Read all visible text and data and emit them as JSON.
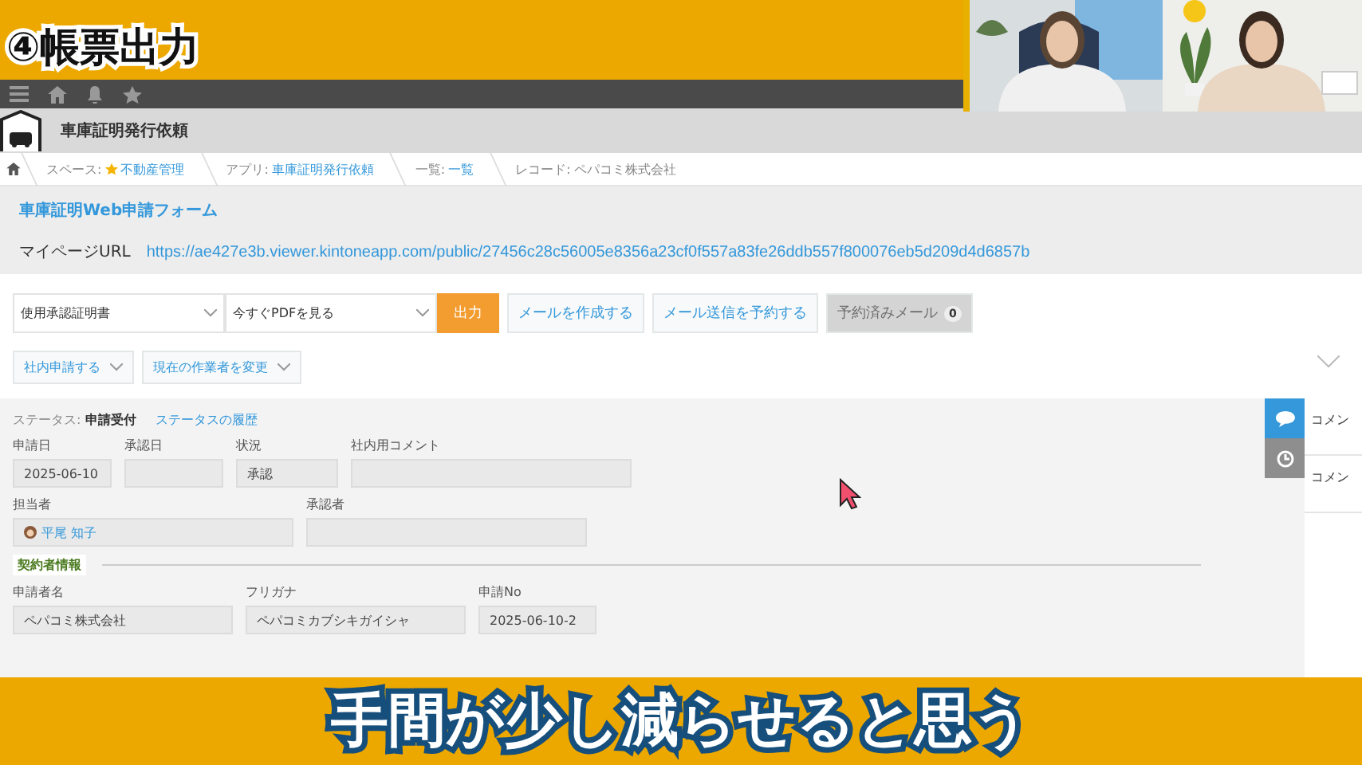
{
  "overlay_title": "④帳票出力",
  "subtitle": "手間が少し減らせると思う",
  "video_tiles": [
    {
      "kind": "picture"
    },
    {
      "kind": "picture"
    }
  ],
  "app": {
    "title": "車庫証明発行依頼"
  },
  "breadcrumb": [
    {
      "prefix": "スペース:",
      "label": "不動産管理",
      "starred": true,
      "link": true
    },
    {
      "prefix": "アプリ:",
      "label": "車庫証明発行依頼",
      "starred": false,
      "link": true
    },
    {
      "prefix": "一覧:",
      "label": "一覧",
      "starred": false,
      "link": true
    },
    {
      "prefix": "レコード:",
      "label": "ペパコミ株式会社",
      "starred": false,
      "link": false
    }
  ],
  "form_header": {
    "title": "車庫証明Web申請フォーム",
    "url_label": "マイページURL",
    "url": "https://ae427e3b.viewer.kintoneapp.com/public/27456c28c56005e8356a23cf0f557a83fe26ddb557f800076eb5d209d4d6857b"
  },
  "toolbar": [
    {
      "kind": "select",
      "value": "使用承認証明書"
    },
    {
      "kind": "select",
      "value": "今すぐPDFを見る"
    },
    {
      "kind": "primary",
      "label": "出力"
    },
    {
      "kind": "button",
      "label": "メールを作成する"
    },
    {
      "kind": "button",
      "label": "メール送信を予約する"
    },
    {
      "kind": "disabled",
      "label": "予約済みメール",
      "badge": "0"
    }
  ],
  "actions": [
    {
      "label": "社内申請する"
    },
    {
      "label": "現在の作業者を変更"
    }
  ],
  "status": {
    "label": "ステータス:",
    "value": "申請受付",
    "history_link": "ステータスの履歴"
  },
  "field_rows": [
    [
      {
        "label": "申請日",
        "value": "2025-06-10",
        "kind": "date"
      },
      {
        "label": "承認日",
        "kind": "date"
      },
      {
        "label": "状況",
        "value": "承認",
        "kind": "short"
      },
      {
        "label": "社内用コメント",
        "kind": "long"
      }
    ],
    [
      {
        "label": "担当者",
        "value": "平尾 知子",
        "kind": "user"
      },
      {
        "label": "承認者",
        "kind": "user"
      }
    ]
  ],
  "group": {
    "label": "契約者情報"
  },
  "group_rows": [
    [
      {
        "label": "申請者名",
        "value": "ペパコミ株式会社",
        "kind": "medium"
      },
      {
        "label": "フリガナ",
        "value": "ペパコミカブシキガイシャ",
        "kind": "medium"
      },
      {
        "label": "申請No",
        "value": "2025-06-10-2",
        "kind": "date2"
      }
    ]
  ],
  "side_tabs": [
    {
      "selected": true
    },
    {
      "selected": false
    }
  ],
  "side_items": [
    "コメン",
    "コメン"
  ]
}
